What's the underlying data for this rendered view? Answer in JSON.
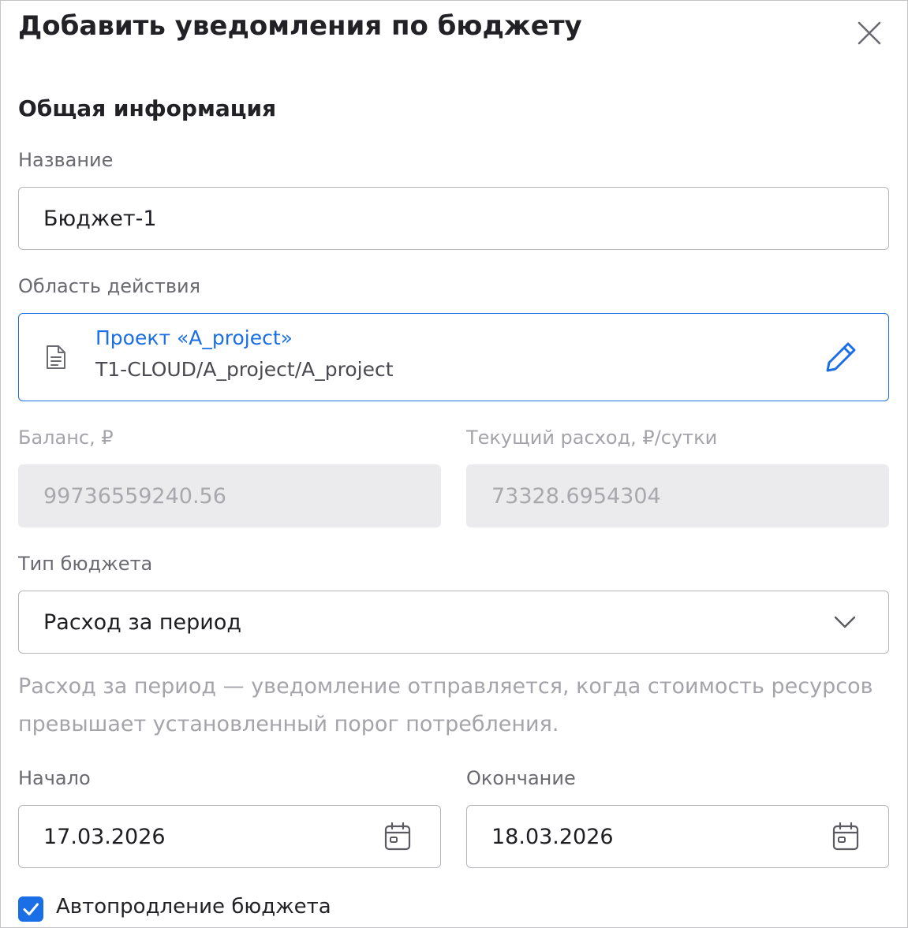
{
  "dialog": {
    "title": "Добавить уведомления по бюджету",
    "close_icon": "close-icon"
  },
  "general": {
    "section_title": "Общая информация",
    "name_label": "Название",
    "name_value": "Бюджет-1",
    "scope_label": "Область действия",
    "scope": {
      "icon": "document-icon",
      "name": "Проект «A_project»",
      "path": "T1-CLOUD/A_project/A_project",
      "edit_icon": "pencil-icon"
    },
    "balance_label": "Баланс, ₽",
    "balance_value": "99736559240.56",
    "expense_label": "Текущий расход, ₽/сутки",
    "expense_value": "73328.6954304",
    "budget_type_label": "Тип бюджета",
    "budget_type_value": "Расход за период",
    "budget_type_hint": "Расход за период — уведомление отправляется, когда стоимость ресурсов превышает установленный порог потребления."
  },
  "period": {
    "start_label": "Начало",
    "start_value": "17.03.2026",
    "end_label": "Окончание",
    "end_value": "18.03.2026",
    "calendar_icon": "calendar-icon"
  },
  "auto_renew": {
    "label": "Автопродление бюджета",
    "checked": true
  },
  "colors": {
    "accent": "#1a6ee6",
    "text": "#222226",
    "muted_text": "#a4a4aa",
    "disabled_bg": "#ebebed",
    "border": "#b4b4ba"
  }
}
